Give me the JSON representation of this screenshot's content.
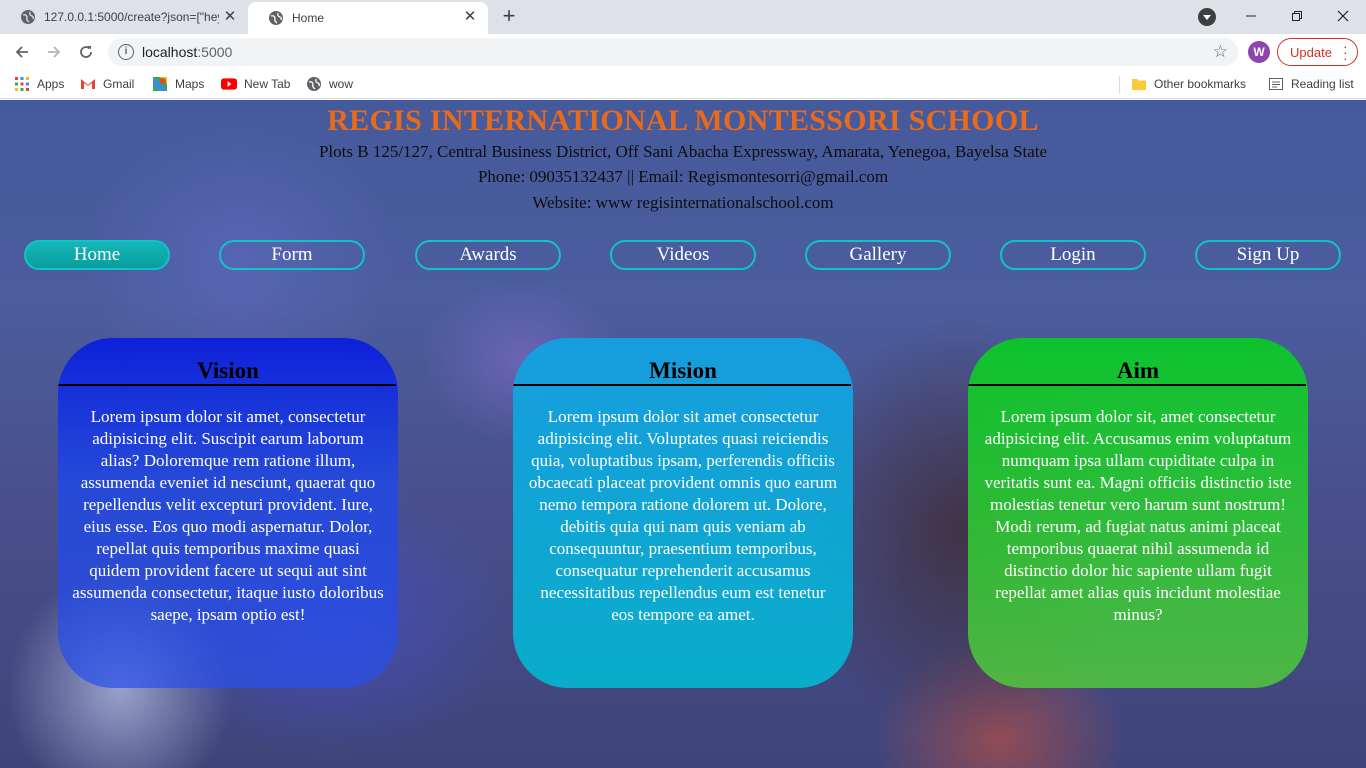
{
  "browser": {
    "tabs": [
      {
        "title": "127.0.0.1:5000/create?json=[\"hey\"",
        "active": false
      },
      {
        "title": "Home",
        "active": true
      }
    ],
    "new_tab_icon": "plus-icon",
    "url_host": "localhost",
    "url_port": ":5000",
    "profile_initial": "W",
    "update_label": "Update",
    "accent_update": "#d93025",
    "bookmarks": [
      {
        "label": "Apps",
        "icon": "apps-grid-icon"
      },
      {
        "label": "Gmail",
        "icon": "gmail-icon"
      },
      {
        "label": "Maps",
        "icon": "maps-icon"
      },
      {
        "label": "New Tab",
        "icon": "youtube-icon"
      },
      {
        "label": "wow",
        "icon": "globe-icon"
      }
    ],
    "other_bookmarks": "Other bookmarks",
    "reading_list": "Reading list"
  },
  "header": {
    "school_name": "REGIS INTERNATIONAL MONTESSORI SCHOOL",
    "address": "Plots B 125/127, Central Business District, Off Sani Abacha Expressway, Amarata, Yenegoa, Bayelsa State",
    "contact": "Phone: 09035132437 || Email: Regismontesorri@gmail.com",
    "website": "Website: www regisinternationalschool.com",
    "title_color": "#e86a1c"
  },
  "nav": {
    "items": [
      "Home",
      "Form",
      "Awards",
      "Videos",
      "Gallery",
      "Login",
      "Sign Up"
    ],
    "active": "Home",
    "accent": "#0fc4c6"
  },
  "cards": [
    {
      "title": "Vision",
      "body": "Lorem ipsum dolor sit amet, consectetur adipisicing elit. Suscipit earum laborum alias? Doloremque rem ratione illum, assumenda eveniet id nesciunt, quaerat quo repellendus velit excepturi provident. Iure, eius esse. Eos quo modi aspernatur. Dolor, repellat quis temporibus maxime quasi quidem provident facere ut sequi aut sint assumenda consectetur, itaque iusto doloribus saepe, ipsam optio est!",
      "color": "#1a3cf0"
    },
    {
      "title": "Mision",
      "body": "Lorem ipsum dolor sit amet consectetur adipisicing elit. Voluptates quasi reiciendis quia, voluptatibus ipsam, perferendis officiis obcaecati placeat provident omnis quo earum nemo tempora ratione dolorem ut. Dolore, debitis quia qui nam quis veniam ab consequuntur, praesentium temporibus, consequatur reprehenderit accusamus necessitatibus repellendus eum est tenetur eos tempore ea amet.",
      "color": "#00bcd8"
    },
    {
      "title": "Aim",
      "body": "Lorem ipsum dolor sit, amet consectetur adipisicing elit. Accusamus enim voluptatum numquam ipsa ullam cupiditate culpa in veritatis sunt ea. Magni officiis distinctio iste molestias tenetur vero harum sunt nostrum! Modi rerum, ad fugiat natus animi placeat temporibus quaerat nihil assumenda id distinctio dolor hic sapiente ullam fugit repellat amet alias quis incidunt molestiae minus?",
      "color": "#22c838"
    }
  ]
}
